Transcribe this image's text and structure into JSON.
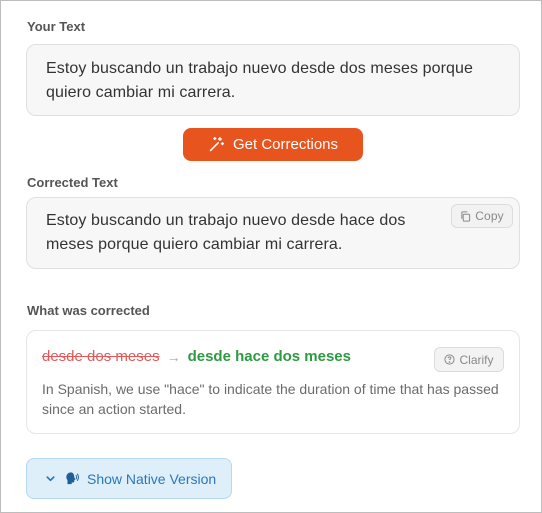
{
  "input_section": {
    "label": "Your Text",
    "text": "Estoy buscando un trabajo nuevo desde dos meses porque quiero cambiar mi carrera."
  },
  "actions": {
    "get_corrections_label": "Get Corrections",
    "get_corrections_icon": "magic-wand-icon",
    "accent_color": "#e8541e"
  },
  "output_section": {
    "label": "Corrected Text",
    "text": "Estoy buscando un trabajo nuevo desde hace dos meses porque quiero cambiar mi carrera.",
    "copy_label": "Copy",
    "copy_icon": "copy-icon"
  },
  "corrections_section": {
    "label": "What was corrected",
    "items": [
      {
        "original": "desde dos meses",
        "arrow": "→",
        "corrected": "desde hace dos meses",
        "clarify_label": "Clarify",
        "clarify_icon": "question-circle-icon",
        "explanation": "In Spanish, we use \"hace\" to indicate the duration of time that has passed since an action started."
      }
    ]
  },
  "native_version": {
    "label": "Show Native Version",
    "chevron_icon": "chevron-down-icon",
    "speaker_icon": "speaking-head-icon"
  }
}
